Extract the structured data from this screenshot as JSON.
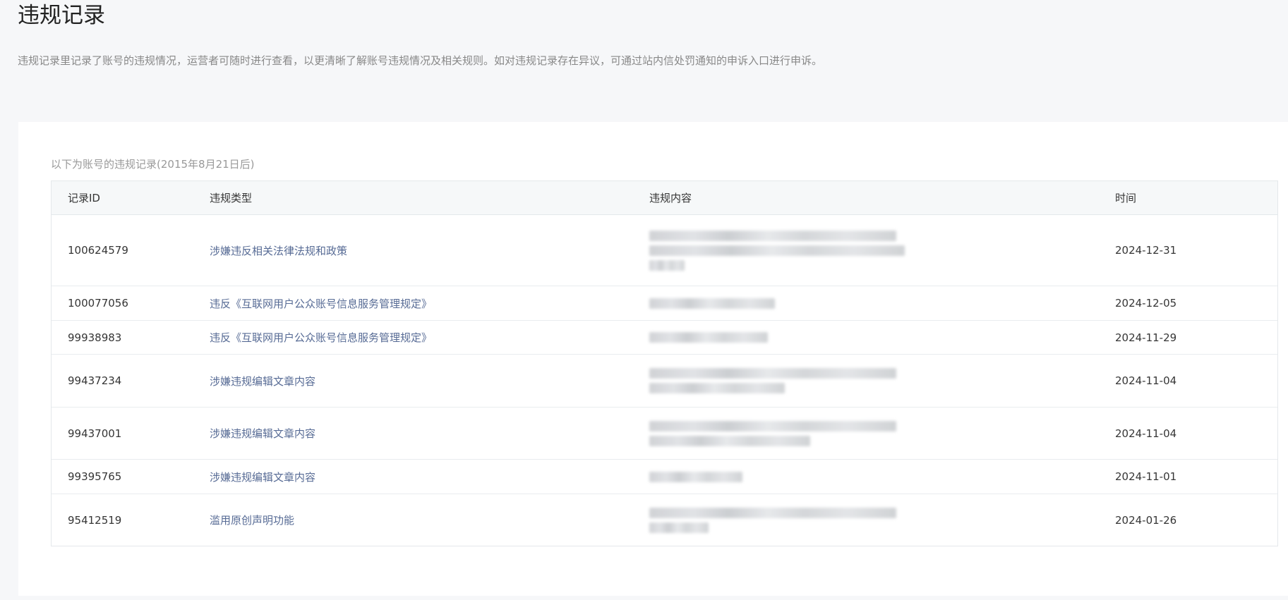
{
  "page": {
    "title": "违规记录",
    "description": "违规记录里记录了账号的违规情况，运营者可随时进行查看，以更清晰了解账号违规情况及相关规则。如对违规记录存在异议，可通过站内信处罚通知的申诉入口进行申诉。"
  },
  "card": {
    "caption": "以下为账号的违规记录(2015年8月21日后)"
  },
  "table": {
    "headers": {
      "id": "记录ID",
      "type": "违规类型",
      "content": "违规内容",
      "time": "时间"
    },
    "rows": [
      {
        "id": "100624579",
        "type": "涉嫌违反相关法律法规和政策",
        "time": "2024-12-31"
      },
      {
        "id": "100077056",
        "type": "违反《互联网用户公众账号信息服务管理规定》",
        "time": "2024-12-05"
      },
      {
        "id": "99938983",
        "type": "违反《互联网用户公众账号信息服务管理规定》",
        "time": "2024-11-29"
      },
      {
        "id": "99437234",
        "type": "涉嫌违规编辑文章内容",
        "time": "2024-11-04"
      },
      {
        "id": "99437001",
        "type": "涉嫌违规编辑文章内容",
        "time": "2024-11-04"
      },
      {
        "id": "99395765",
        "type": "涉嫌违规编辑文章内容",
        "time": "2024-11-01"
      },
      {
        "id": "95412519",
        "type": "滥用原创声明功能",
        "time": "2024-01-26"
      }
    ]
  },
  "colors": {
    "background": "#f6f7f9",
    "card": "#ffffff",
    "link_text": "#576b95",
    "header_bg": "#f6f8f9",
    "border": "#e4e8eb"
  }
}
